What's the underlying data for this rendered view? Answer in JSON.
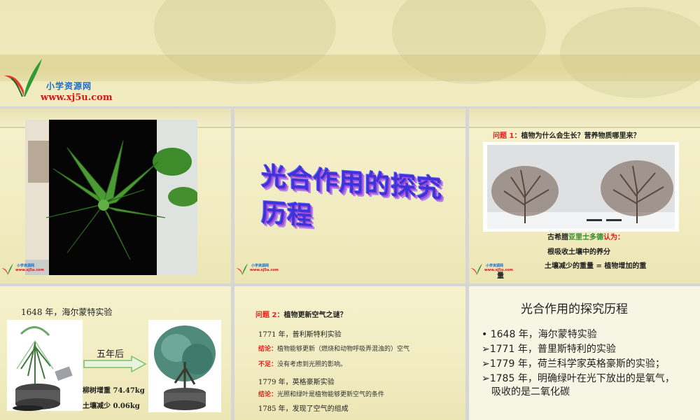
{
  "logo": {
    "cn": "小学资源网",
    "url": "www.xj5u.com"
  },
  "mini_logo": {
    "cn": "小学资源网",
    "url": "www.xj5u.com"
  },
  "slide2": {
    "title": "光合作用的探究历程"
  },
  "slide3": {
    "q_label": "问题 1：",
    "q_text": "植物为什么会生长？营养物质哪里来？",
    "greek_prefix": "古希腊",
    "aristotle": "亚里士多德",
    "greek_suffix": "认为：",
    "line1": "根吸收土壤中的养分",
    "line2": "土壤减少的重量 = 植物增加的重",
    "line3": "量"
  },
  "slide4": {
    "title": "1648 年，海尔蒙特实验",
    "arrow_label": "五年后",
    "result1": "柳树增重 74.47kg",
    "result2": "土壤减少 0.06kg"
  },
  "slide5": {
    "q_label": "问题 2：",
    "q_text": "植物更新空气之谜？",
    "l1": "1771 年，普利斯特利实验",
    "c1_label": "结论：",
    "c1": "植物能够更新（燃烧和动物呼吸弄混浊的）空气",
    "n1_label": "不足：",
    "n1": "没有考虑到光照的影响。",
    "l2": "1779 年，英格豪斯实验",
    "c2_label": "结论：",
    "c2": "光照和绿叶是植物能够更新空气的条件",
    "l3": "1785 年，发现了空气的组成"
  },
  "slide6": {
    "title": "光合作用的探究历程",
    "items": [
      {
        "bullet": "•",
        "text": "1648 年，海尔蒙特实验"
      },
      {
        "bullet": "➢",
        "text": "1771 年，普里斯特利的实验"
      },
      {
        "bullet": "➢",
        "text": "1779 年，荷兰科学家英格豪斯的实验；"
      },
      {
        "bullet": "➢",
        "text": "1785 年，明确绿叶在光下放出的是氧气，"
      }
    ],
    "continuation": "吸收的是二氧化碳"
  },
  "colors": {
    "accent_red": "#e0231d",
    "accent_green": "#2b8f2b",
    "title_purple": "#3e33d9"
  }
}
